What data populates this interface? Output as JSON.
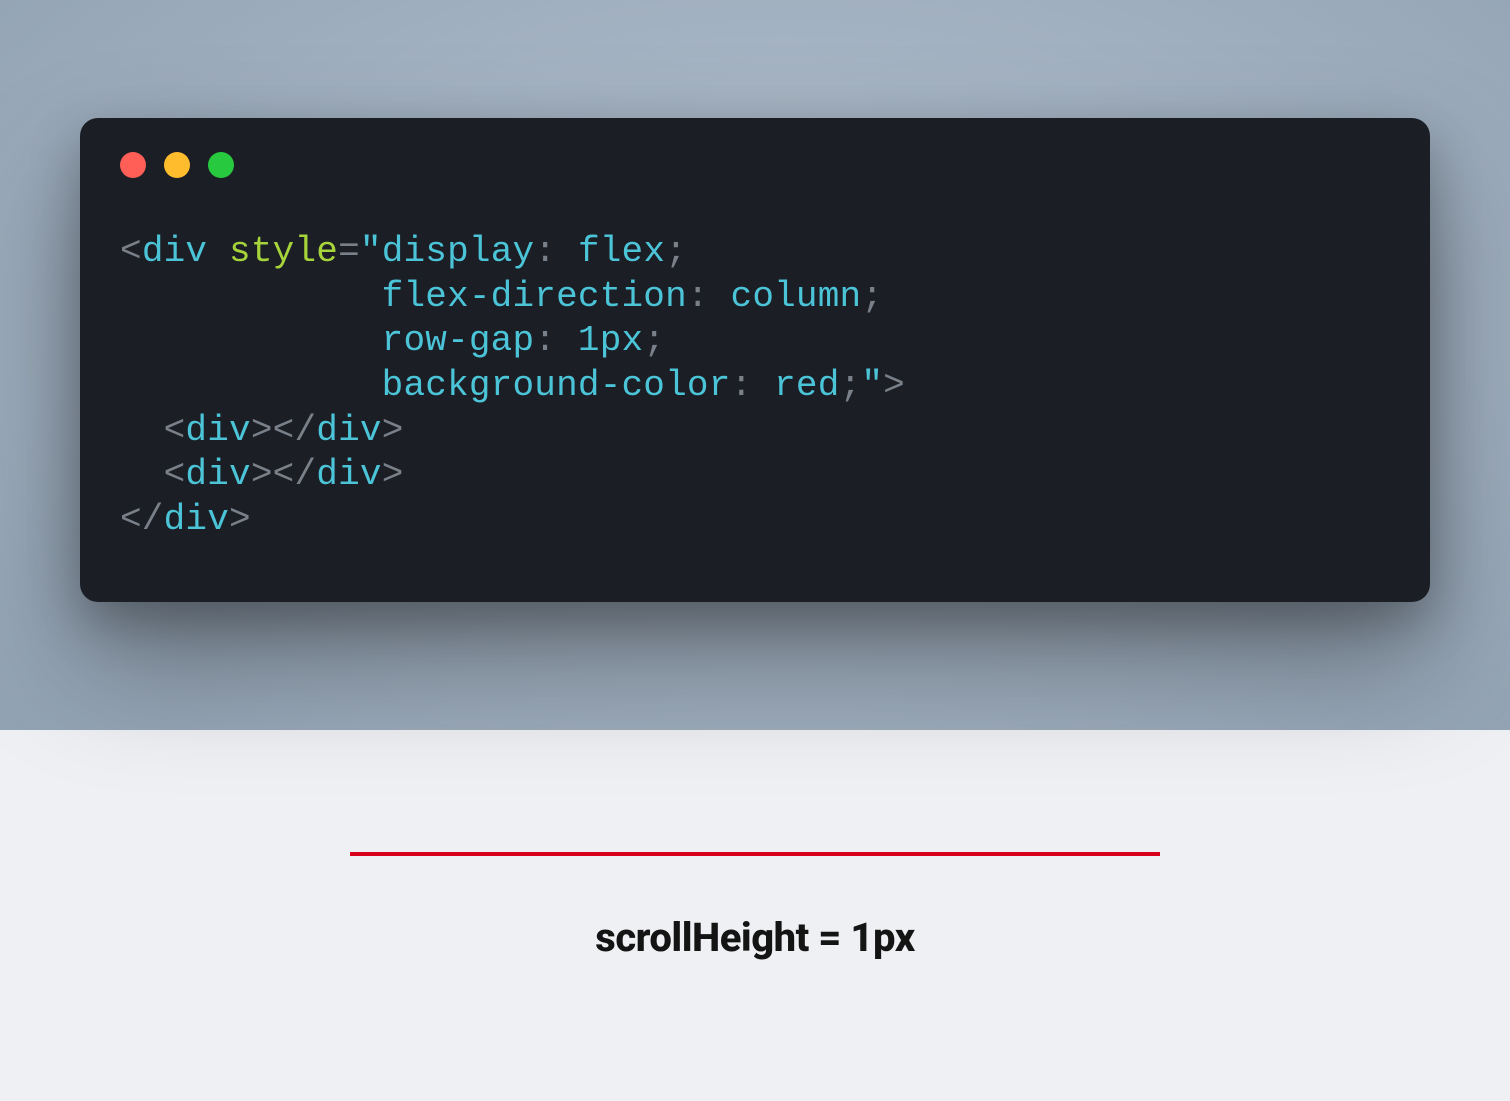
{
  "code": {
    "tag": "div",
    "attr_name": "style",
    "css": {
      "prop1": "display",
      "val1": "flex",
      "prop2": "flex-direction",
      "val2": "column",
      "prop3": "row-gap",
      "val3": "1px",
      "prop4": "background-color",
      "val4": "red"
    },
    "child_tag": "div",
    "close_tag": "div"
  },
  "demo": {
    "css_display": "flex",
    "css_flex_direction": "column",
    "css_row_gap": "1px",
    "css_background_color": "red"
  },
  "caption": "scrollHeight = 1px",
  "colors": {
    "window_bg": "#1b1e25",
    "traffic_red": "#ff5f56",
    "traffic_yellow": "#ffbd2e",
    "traffic_green": "#27c93f",
    "token_default": "#4cc4d8",
    "token_attr": "#a6d43b",
    "token_punct": "#7a808a",
    "demo_bg": "#d8001a"
  }
}
